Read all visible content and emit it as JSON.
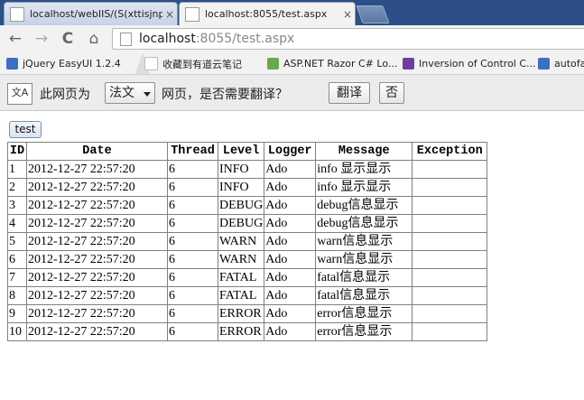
{
  "browser": {
    "tabs": [
      {
        "title": "localhost/webIIS/(S(xttisjnpr"
      },
      {
        "title": "localhost:8055/test.aspx"
      }
    ],
    "close_glyph": "×",
    "nav": {
      "back": "←",
      "forward": "→",
      "reload": "C",
      "home": "⌂"
    },
    "address": {
      "host": "localhost",
      "rest": ":8055/test.aspx"
    },
    "bookmarks": [
      {
        "label": "jQuery EasyUI 1.2.4",
        "icon": "bookmark-icon",
        "color": "#3a6fc4"
      },
      {
        "label": "收藏到有道云笔记",
        "icon": "bookmark-icon",
        "color": "#ffffff"
      },
      {
        "label": "ASP.NET Razor C# Lo...",
        "icon": "bookmark-icon",
        "color": "#6aa84f"
      },
      {
        "label": "Inversion of Control C...",
        "icon": "bookmark-icon",
        "color": "#6b3fa0"
      },
      {
        "label": "autofa",
        "icon": "bookmark-icon",
        "color": "#3a6fc4"
      }
    ]
  },
  "translate": {
    "icon_text": "文A",
    "prefix": "此网页为",
    "language": "法文",
    "suffix": "网页，是否需要翻译？",
    "translate_button": "翻译",
    "no_button": "否"
  },
  "page": {
    "test_button": "test",
    "table": {
      "headers": [
        "ID",
        "Date",
        "Thread",
        "Level",
        "Logger",
        "Message",
        "Exception"
      ],
      "rows": [
        [
          "1",
          "2012-12-27 22:57:20",
          "6",
          "INFO",
          "Ado",
          "info 显示显示",
          ""
        ],
        [
          "2",
          "2012-12-27 22:57:20",
          "6",
          "INFO",
          "Ado",
          "info 显示显示",
          ""
        ],
        [
          "3",
          "2012-12-27 22:57:20",
          "6",
          "DEBUG",
          "Ado",
          "debug信息显示",
          ""
        ],
        [
          "4",
          "2012-12-27 22:57:20",
          "6",
          "DEBUG",
          "Ado",
          "debug信息显示",
          ""
        ],
        [
          "5",
          "2012-12-27 22:57:20",
          "6",
          "WARN",
          "Ado",
          "warn信息显示",
          ""
        ],
        [
          "6",
          "2012-12-27 22:57:20",
          "6",
          "WARN",
          "Ado",
          "warn信息显示",
          ""
        ],
        [
          "7",
          "2012-12-27 22:57:20",
          "6",
          "FATAL",
          "Ado",
          "fatal信息显示",
          ""
        ],
        [
          "8",
          "2012-12-27 22:57:20",
          "6",
          "FATAL",
          "Ado",
          "fatal信息显示",
          ""
        ],
        [
          "9",
          "2012-12-27 22:57:20",
          "6",
          "ERROR",
          "Ado",
          "error信息显示",
          ""
        ],
        [
          "10",
          "2012-12-27 22:57:20",
          "6",
          "ERROR",
          "Ado",
          "error信息显示",
          ""
        ]
      ]
    }
  }
}
